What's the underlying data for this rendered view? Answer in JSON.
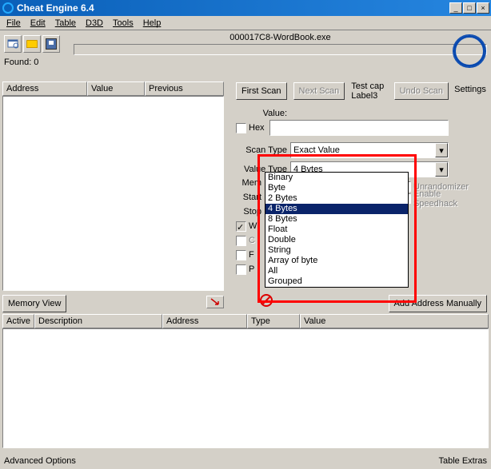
{
  "window": {
    "title": "Cheat Engine 6.4"
  },
  "menu": {
    "file": "File",
    "edit": "Edit",
    "table": "Table",
    "d3d": "D3D",
    "tools": "Tools",
    "help": "Help"
  },
  "toolbar": {
    "process_title": "000017C8-WordBook.exe"
  },
  "logo": {
    "settings": "Settings"
  },
  "found": {
    "label": "Found: 0"
  },
  "left_cols": {
    "address": "Address",
    "value": "Value",
    "previous": "Previous"
  },
  "scan": {
    "first": "First Scan",
    "next": "Next Scan",
    "undo": "Undo Scan",
    "testcap": "Test cap",
    "label3": "Label3"
  },
  "value_section": {
    "label": "Value:",
    "hex": "Hex"
  },
  "scan_type": {
    "label": "Scan Type",
    "selected": "Exact Value"
  },
  "value_type": {
    "label": "Value Type",
    "selected": "4 Bytes",
    "options": [
      "Binary",
      "Byte",
      "2 Bytes",
      "4 Bytes",
      "8 Bytes",
      "Float",
      "Double",
      "String",
      "Array of byte",
      "All",
      "Grouped"
    ]
  },
  "mem": {
    "mem_label": "Mem",
    "start_label": "Start",
    "stop_label": "Stop",
    "w": "W",
    "c": "C",
    "f": "F",
    "p": "P"
  },
  "right_opts": {
    "unrandomizer": "Unrandomizer",
    "speedhack": "Enable Speedhack"
  },
  "buttons": {
    "memory_view": "Memory View",
    "add_address": "Add Address Manually"
  },
  "bottom_cols": {
    "active": "Active",
    "description": "Description",
    "address": "Address",
    "type": "Type",
    "value": "Value"
  },
  "bottom_bar": {
    "advanced": "Advanced Options",
    "extras": "Table Extras"
  }
}
